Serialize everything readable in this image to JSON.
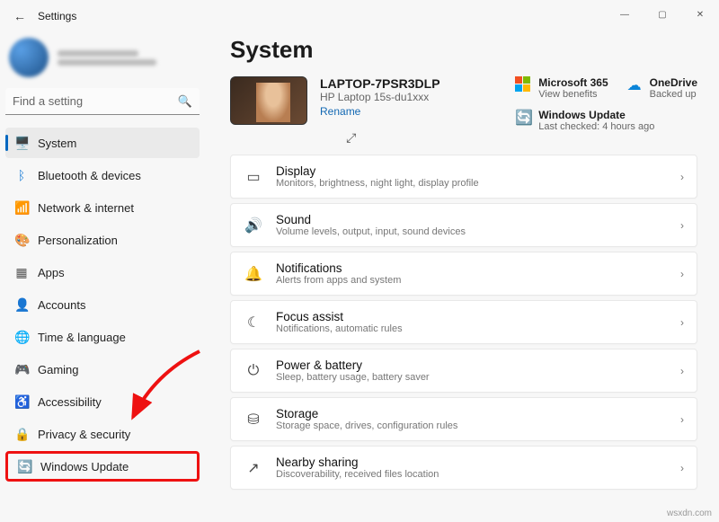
{
  "window": {
    "title": "Settings"
  },
  "user": {
    "name": "",
    "email": ""
  },
  "search": {
    "placeholder": "Find a setting"
  },
  "sidebar": {
    "items": [
      {
        "label": "System",
        "icon": "🖥️"
      },
      {
        "label": "Bluetooth & devices",
        "icon": "ᛒ"
      },
      {
        "label": "Network & internet",
        "icon": "📶"
      },
      {
        "label": "Personalization",
        "icon": "🎨"
      },
      {
        "label": "Apps",
        "icon": "▦"
      },
      {
        "label": "Accounts",
        "icon": "👤"
      },
      {
        "label": "Time & language",
        "icon": "🌐"
      },
      {
        "label": "Gaming",
        "icon": "🎮"
      },
      {
        "label": "Accessibility",
        "icon": "♿"
      },
      {
        "label": "Privacy & security",
        "icon": "🔒"
      },
      {
        "label": "Windows Update",
        "icon": "🔄"
      }
    ]
  },
  "page": {
    "title": "System"
  },
  "device": {
    "name": "LAPTOP-7PSR3DLP",
    "model": "HP Laptop 15s-du1xxx",
    "rename": "Rename"
  },
  "hero": {
    "ms365": {
      "title": "Microsoft 365",
      "sub": "View benefits"
    },
    "onedrive": {
      "title": "OneDrive",
      "sub": "Backed up"
    },
    "wu": {
      "title": "Windows Update",
      "sub": "Last checked: 4 hours ago"
    }
  },
  "cards": [
    {
      "icon": "▭",
      "title": "Display",
      "sub": "Monitors, brightness, night light, display profile"
    },
    {
      "icon": "🔊",
      "title": "Sound",
      "sub": "Volume levels, output, input, sound devices"
    },
    {
      "icon": "🔔",
      "title": "Notifications",
      "sub": "Alerts from apps and system"
    },
    {
      "icon": "☾",
      "title": "Focus assist",
      "sub": "Notifications, automatic rules"
    },
    {
      "icon": "⏻",
      "title": "Power & battery",
      "sub": "Sleep, battery usage, battery saver"
    },
    {
      "icon": "⛁",
      "title": "Storage",
      "sub": "Storage space, drives, configuration rules"
    },
    {
      "icon": "↗",
      "title": "Nearby sharing",
      "sub": "Discoverability, received files location"
    }
  ],
  "watermark": "wsxdn.com"
}
